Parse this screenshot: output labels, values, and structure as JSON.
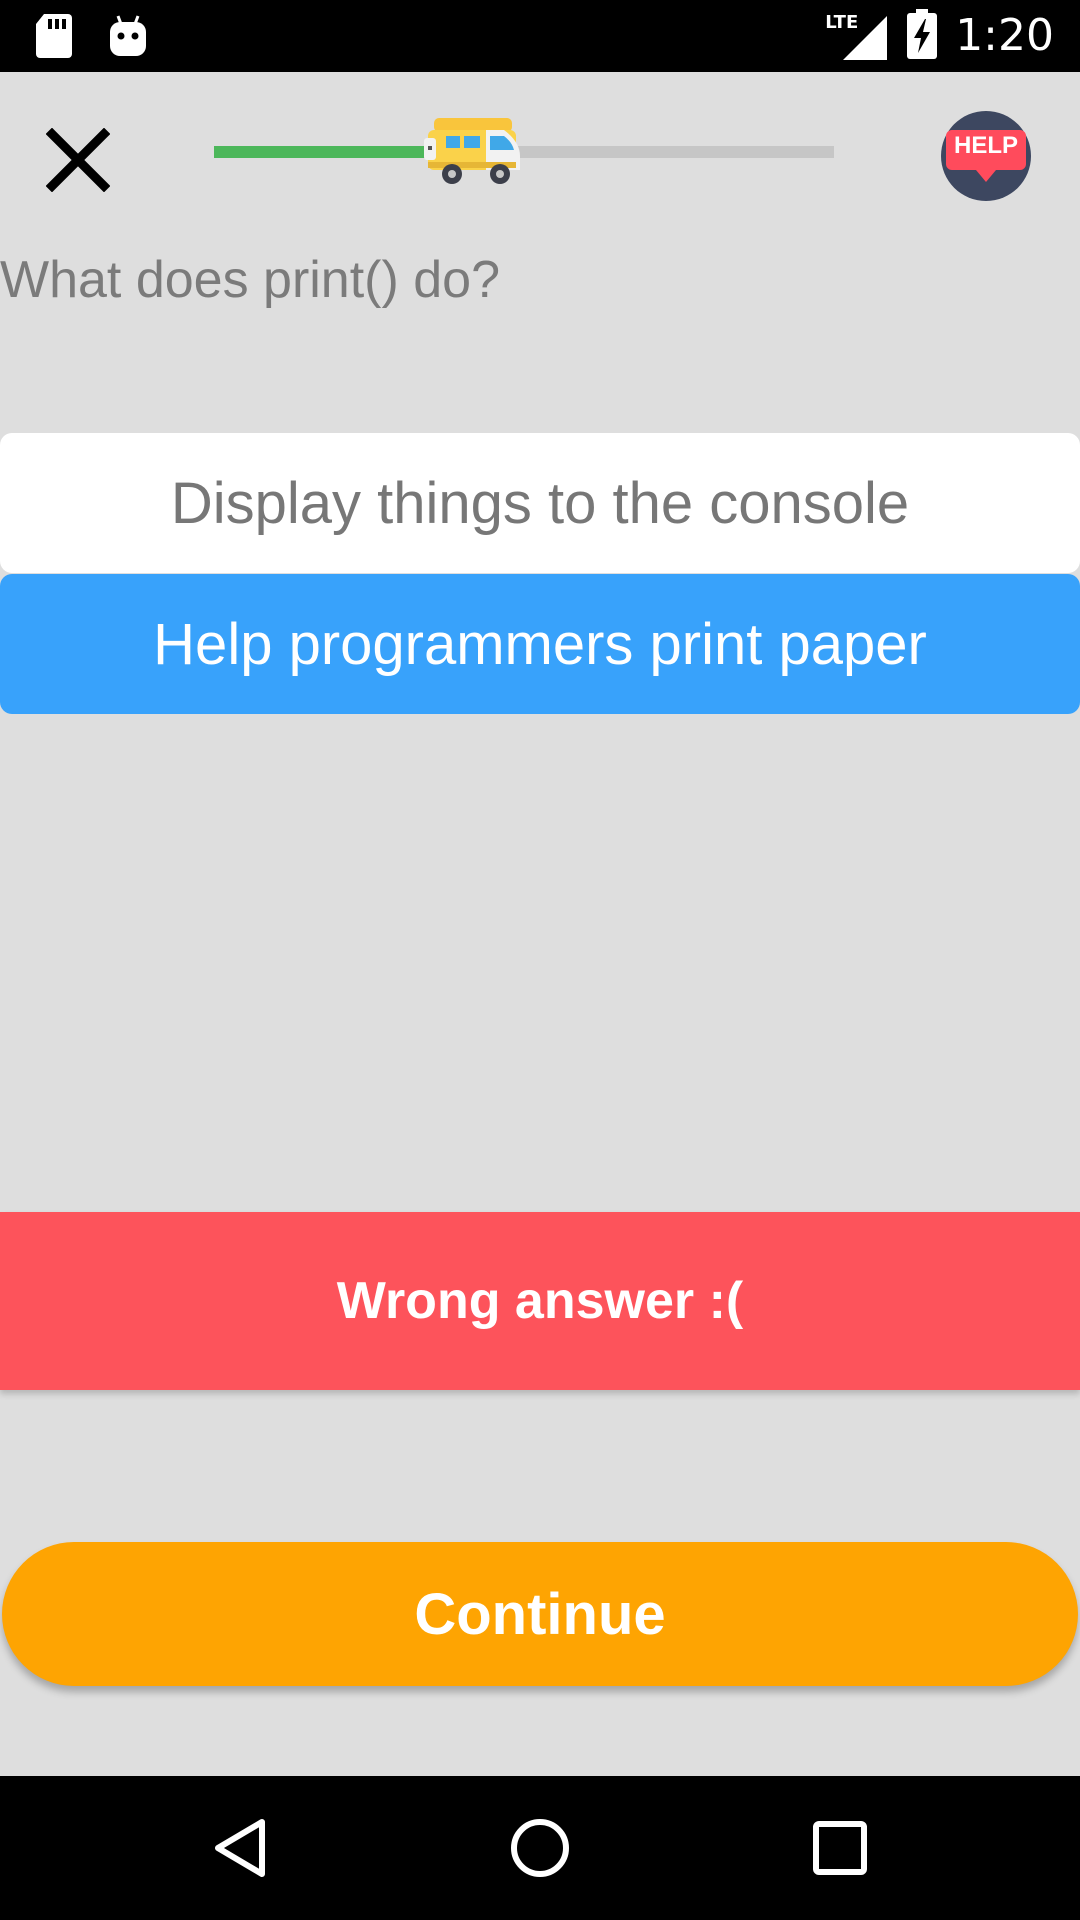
{
  "status_bar": {
    "time": "1:20",
    "network_label": "LTE",
    "icons": [
      "sd-card-icon",
      "android-debug-icon",
      "signal-icon",
      "battery-charging-icon"
    ]
  },
  "top_bar": {
    "close_icon": "close-icon",
    "progress_fraction": 0.42,
    "progress_marker_icon": "camper-van-icon",
    "help_label": "HELP"
  },
  "question": {
    "text": "What does print() do?"
  },
  "answers": [
    {
      "label": "Display things to the console",
      "state": "unselected"
    },
    {
      "label": "Help programmers print paper",
      "state": "selected"
    }
  ],
  "feedback": {
    "text": "Wrong answer :("
  },
  "actions": {
    "continue_label": "Continue"
  },
  "colors": {
    "background": "#dedede",
    "progress_done": "#4cb75a",
    "progress_remaining": "#c6c6c6",
    "selected_answer": "#38a2fb",
    "wrong_banner": "#fd535b",
    "continue_button": "#fea402",
    "help_badge": "#ff4b5c"
  },
  "nav_bar": {
    "icons": [
      "back-icon",
      "home-icon",
      "recents-icon"
    ]
  }
}
